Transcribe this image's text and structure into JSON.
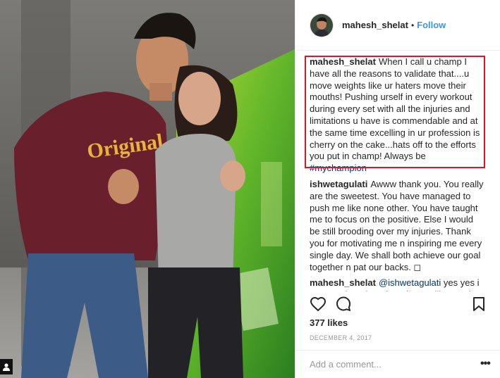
{
  "post": {
    "author": "mahesh_shelat",
    "follow_label": "Follow",
    "separator": "•"
  },
  "comments": [
    {
      "user": "mahesh_shelat",
      "text": "When I call u champ I have all the reasons to validate that....u move weights like ur haters move their mouths! Pushing urself in every workout during every set with all the injuries and limitations u have is commendable and at the same time excelling in ur profession is cherry on the cake...hats off to the efforts you put in champ! Always be",
      "mention": "#mychampion"
    },
    {
      "user": "ishwetagulati",
      "text": "Awww thank you. You really are the sweetest. You have managed to push me like none other. You have taught me to focus on the positive. Else I would be still brooding over my injuries. Thank you for motivating me n inspiring me every single day. We shall both achieve our goal together n pat our backs. ◻"
    },
    {
      "user": "mahesh_shelat",
      "mention": "@ishwetagulati",
      "text": "yes yes i m sure about it... Though we will never be"
    }
  ],
  "likes": "377 likes",
  "date": "DECEMBER 4, 2017",
  "add_comment_placeholder": "Add a comment...",
  "more_label": "•••",
  "icons": {
    "like": "heart-icon",
    "comment": "comment-icon",
    "save": "bookmark-icon",
    "more": "more-options-icon",
    "user": "user-icon"
  },
  "colors": {
    "link": "#3897f0",
    "highlight": "#e3122b",
    "mention": "#003569"
  }
}
